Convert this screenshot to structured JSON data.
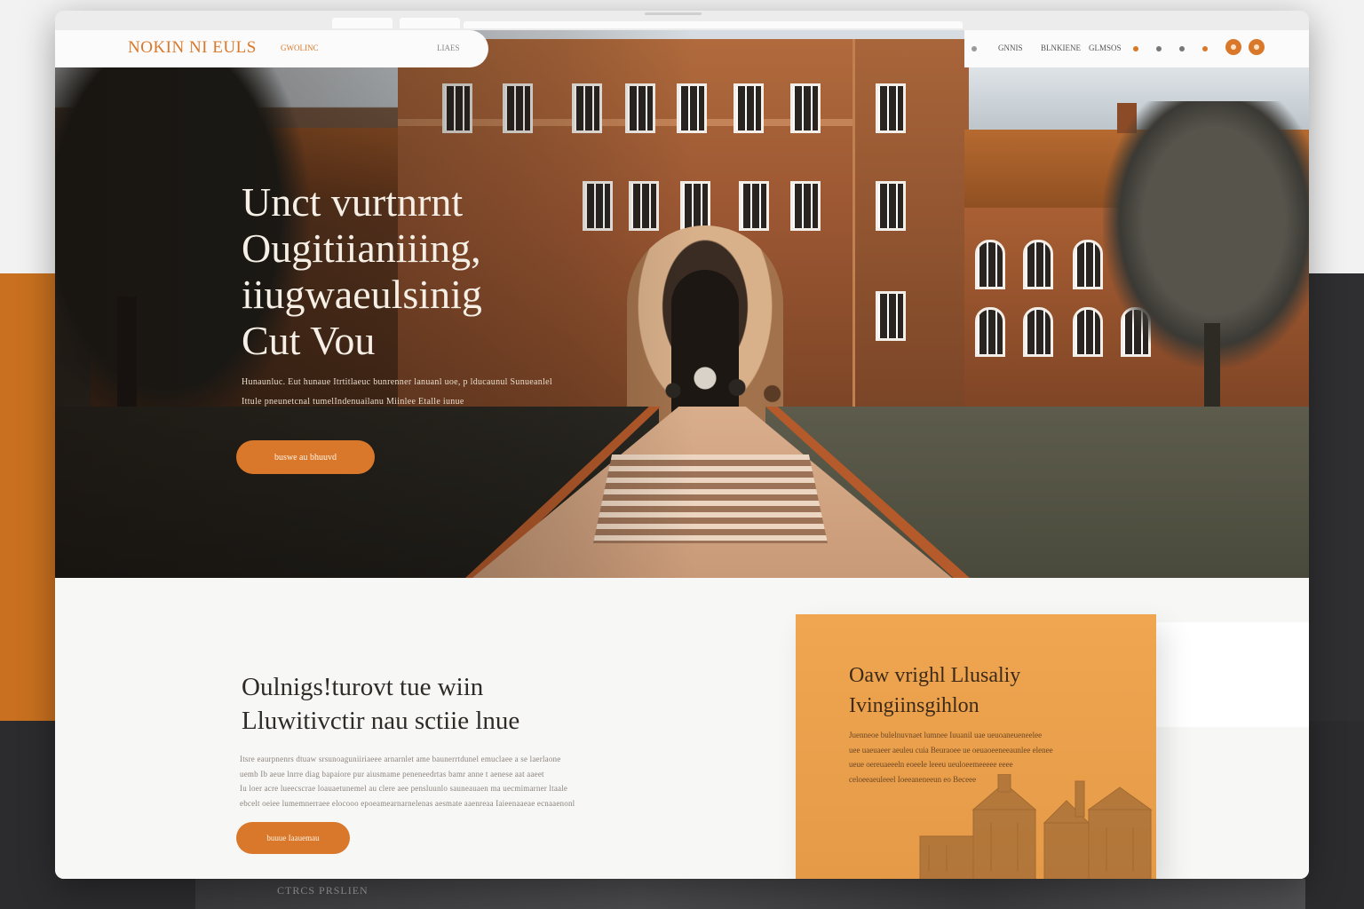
{
  "backdrop": {
    "bottom_caption": "CTRCS PRSLIEN"
  },
  "nav": {
    "brand": "NOKIN NI EULS",
    "left_links": [
      "GWOLINC",
      "LIAES"
    ],
    "right_links": [
      "GNNIS",
      "BLNKIENE",
      "GLMSOS"
    ],
    "accent_color": "#d9782a"
  },
  "hero": {
    "headline_lines": [
      "Unct vurtnrnt",
      "Ougitiianiiing,",
      "iiugwaeulsinig",
      "Cut Vou"
    ],
    "sub_lines": [
      "Hunaunluc. Eut hunaue Itrtitlaeuc bunrenner lanuanl uoe, p lducaunul Sunueanlel",
      "Ittule pneunetcnal tumelIndenuailanu Miinlee Etalle iunue"
    ],
    "cta_label": "buswe au bhuuvd"
  },
  "section": {
    "headline_lines": [
      "Oulnigs!turovt tue wiin",
      "Lluwitivctir nau sctiie lnue"
    ],
    "body_lines": [
      "Itsre eaurpnenrs dtuaw srsunoaguniiriaeee arnarnlet ame baunerrtdunel emuclaee a se laerlaone",
      "uemb Ib aeue lnrre diag bapaiore pur aiusmame peneneedrtas bamr anne t aenese aat aaeet",
      "Iu loer acre lueecscrae loauaetunemel au clere aee pensluunlo sauneauaen ma uecmimarner ltaale",
      "ebcelt oeiee lumemnerraee elocooo epoeamearnarnelenas aesmate aaenreaa Iaieenaaeae ecnaaenonl"
    ],
    "cta_label": "buuue Iaauemau"
  },
  "card": {
    "title_lines": [
      "Oaw vrighl Llusaliy",
      "Ivingiinsgihlon"
    ],
    "body_lines": [
      "Juenneoe bulelnuvnaet lumnee Iuuanil uae ueuoaneueneelee",
      "uee uaeuaeer aeuleu cuia Beuraoee ue oeuaoeeneeaunlee elenee",
      "ueue oereuaeeeln eoeeIe leeeu ueuloeemeeeee eeee",
      "celoeeaeuleeel Ioeeaneneeun eo Beceee"
    ],
    "accent_color": "#f0a650"
  }
}
